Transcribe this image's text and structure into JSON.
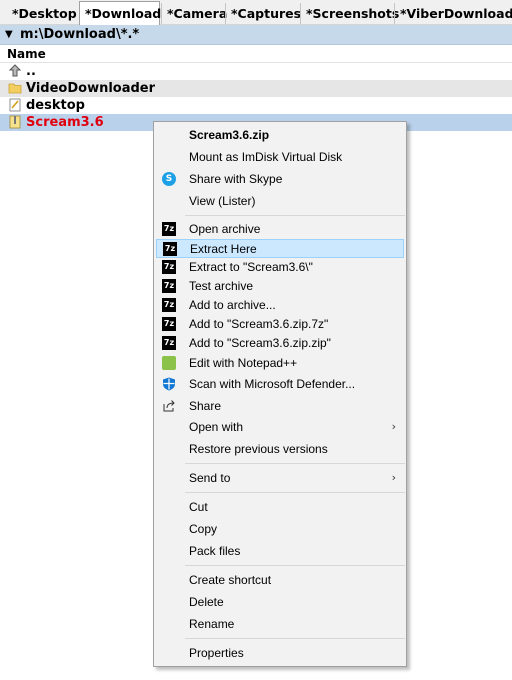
{
  "tabs": [
    "*Desktop",
    "*Download",
    "*Camera",
    "*Captures",
    "*Screenshots",
    "*ViberDownloads"
  ],
  "active_tab": "*Download",
  "path": "m:\\Download\\*.*",
  "column_header": "Name",
  "files": [
    {
      "name": "..",
      "icon": "up-dir-icon"
    },
    {
      "name": "VideoDownloader",
      "icon": "folder-icon"
    },
    {
      "name": "desktop",
      "icon": "ini-file-icon"
    },
    {
      "name": "Scream3.6",
      "icon": "zip-file-icon"
    }
  ],
  "menu": {
    "title": "Scream3.6.zip",
    "items": {
      "mount": "Mount as ImDisk Virtual Disk",
      "skype": "Share with Skype",
      "view": "View (Lister)",
      "open_archive": "Open archive",
      "extract_here": "Extract Here",
      "extract_to": "Extract to \"Scream3.6\\\"",
      "test": "Test archive",
      "add": "Add to archive...",
      "add_7z": "Add to \"Scream3.6.zip.7z\"",
      "add_zip": "Add to \"Scream3.6.zip.zip\"",
      "notepad": "Edit with Notepad++",
      "defender": "Scan with Microsoft Defender...",
      "share": "Share",
      "open_with": "Open with",
      "restore": "Restore previous versions",
      "send_to": "Send to",
      "cut": "Cut",
      "copy": "Copy",
      "pack": "Pack files",
      "shortcut": "Create shortcut",
      "delete": "Delete",
      "rename": "Rename",
      "properties": "Properties"
    },
    "zip_icon_text": "7z"
  }
}
